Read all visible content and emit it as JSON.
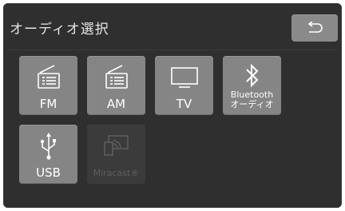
{
  "header": {
    "title": "オーディオ選択",
    "back_icon": "return-arrow-icon"
  },
  "sources": [
    {
      "label": "FM",
      "icon": "radio-icon",
      "enabled": true
    },
    {
      "label": "AM",
      "icon": "radio-icon",
      "enabled": true
    },
    {
      "label": "TV",
      "icon": "tv-icon",
      "enabled": true
    },
    {
      "label_line1": "Bluetooth",
      "label_line2": "オーディオ",
      "icon": "bluetooth-icon",
      "enabled": true
    },
    {
      "label": "USB",
      "icon": "usb-icon",
      "enabled": true
    },
    {
      "label": "Miracast®",
      "icon": "miracast-icon",
      "enabled": false
    }
  ],
  "colors": {
    "background": "#2f2f2f",
    "tile": "#858585",
    "tile_disabled": "#3b3b3b",
    "text": "#ffffff"
  }
}
